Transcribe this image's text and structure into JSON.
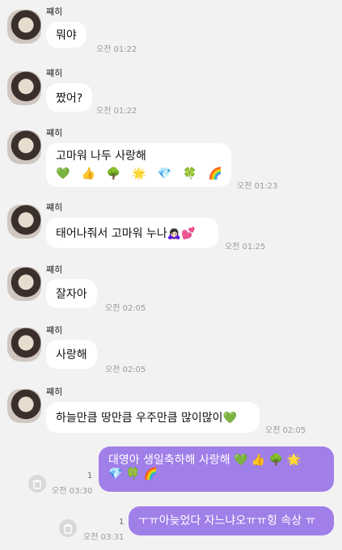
{
  "sender_name": "쨰히",
  "messages": [
    {
      "text": "뭐야",
      "time": "오전 01:22"
    },
    {
      "text": "짰어?",
      "time": "오전 01:22"
    },
    {
      "text": "고마워 나두 사랑해",
      "emojis": [
        "💚",
        "👍",
        "🌳",
        "🌟",
        "💎",
        "🍀",
        "🌈"
      ],
      "time": "오전 01:23"
    },
    {
      "text": "태어나줘서 고마워 누나🙇🏻‍♀️💕",
      "time": "오전 01:25"
    },
    {
      "text": "잘자아",
      "time": "오전 02:05"
    },
    {
      "text": "사랑해",
      "time": "오전 02:05"
    },
    {
      "text": "하늘만큼 땅만큼 우주만큼 많이많이💚",
      "time": "오전 02:05"
    }
  ],
  "my_messages": [
    {
      "line1": "대영아 생일축하해 사랑해 💚 👍 🌳 🌟",
      "line2": "💎 🍀 🌈",
      "time": "오전 03:30",
      "unread": "1"
    },
    {
      "text": "ㅜㅠ아늦었다 자느냐오ㅠㅠ힝 속상 ㅠ",
      "time": "오전 03:31",
      "unread": "1"
    }
  ],
  "icons": {
    "avatar": "profile-photo",
    "delete": "trash-icon"
  },
  "colors": {
    "background": "#f2f2f2",
    "my_bubble": "#a07fe9",
    "their_bubble": "#ffffff"
  }
}
